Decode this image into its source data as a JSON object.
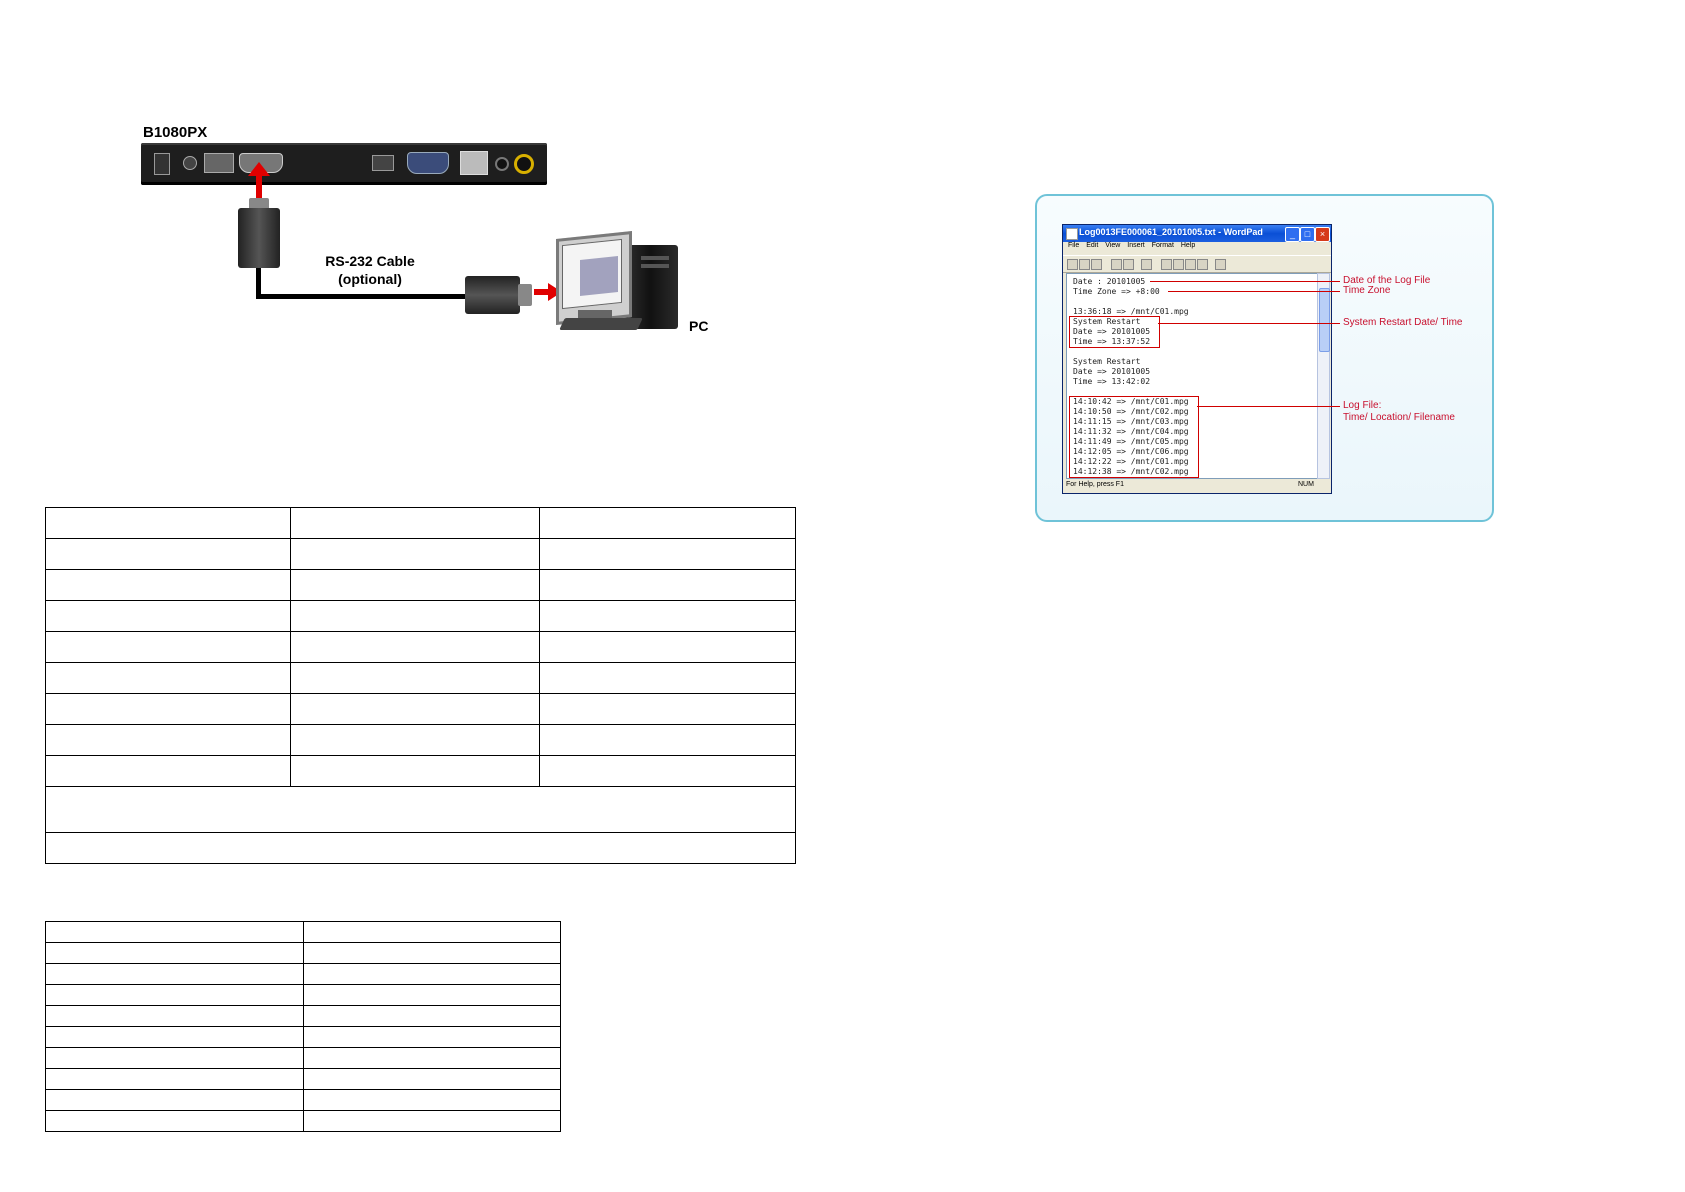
{
  "diagram": {
    "device_label": "B1080PX",
    "cable_title": "RS-232 Cable",
    "cable_note": "(optional)",
    "pc_label": "PC",
    "accent_red": "#e00000"
  },
  "wordpad": {
    "title": "Log0013FE000061_20101005.txt - WordPad",
    "menu": [
      "File",
      "Edit",
      "View",
      "Insert",
      "Format",
      "Help"
    ],
    "lines": [
      "Date : 20101005",
      "Time Zone => +8:00",
      "",
      "13:36:18 => /mnt/C01.mpg",
      "System Restart",
      "Date => 20101005",
      "Time => 13:37:52",
      "",
      "System Restart",
      "Date => 20101005",
      "Time => 13:42:02",
      "",
      "14:10:42 => /mnt/C01.mpg",
      "14:10:50 => /mnt/C02.mpg",
      "14:11:15 => /mnt/C03.mpg",
      "14:11:32 => /mnt/C04.mpg",
      "14:11:49 => /mnt/C05.mpg",
      "14:12:05 => /mnt/C06.mpg",
      "14:12:22 => /mnt/C01.mpg",
      "14:12:38 => /mnt/C02.mpg"
    ],
    "status_left": "For Help, press F1",
    "status_right": "NUM"
  },
  "callouts": {
    "date": "Date of the Log File",
    "timezone": "Time Zone",
    "restart": "System Restart Date/ Time",
    "logfile_1": "Log File:",
    "logfile_2": "Time/ Location/ Filename",
    "color": "#c8102e"
  }
}
